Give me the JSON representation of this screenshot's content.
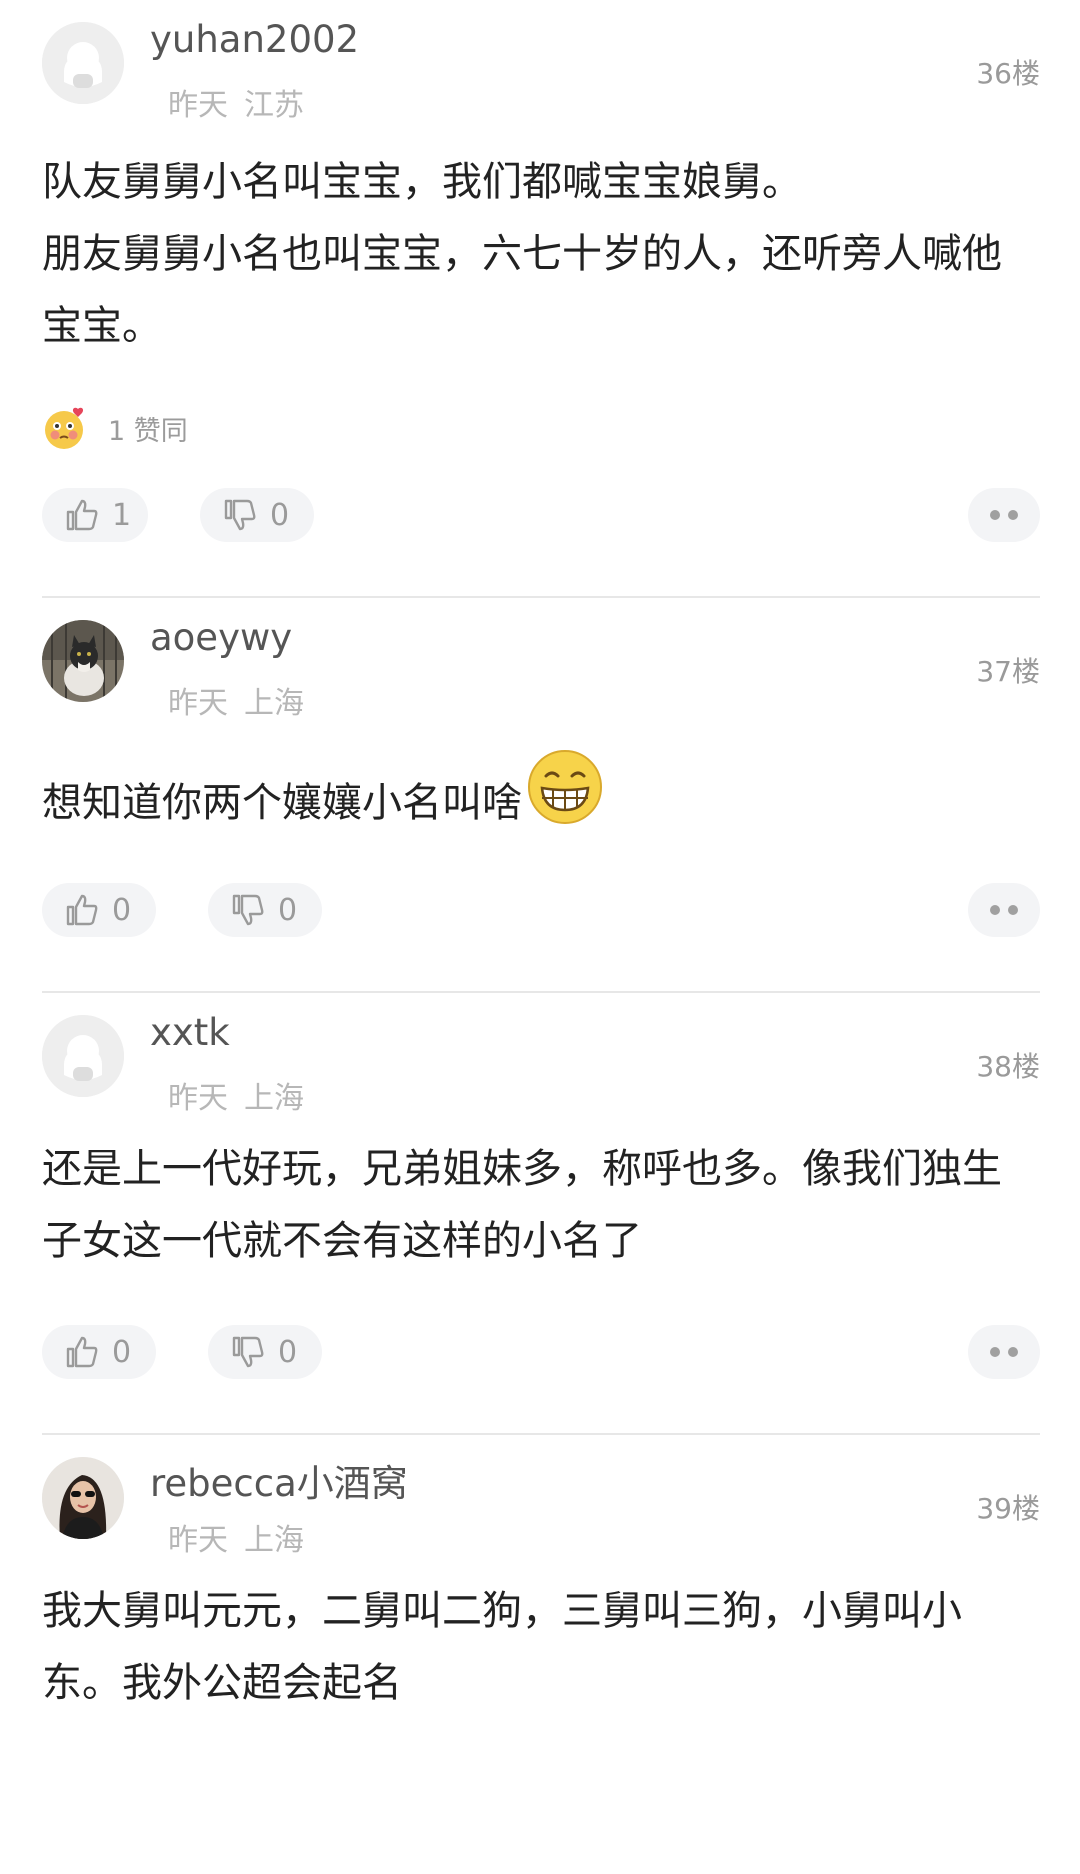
{
  "comments": [
    {
      "username": "yuhan2002",
      "time": "昨天",
      "location": "江苏",
      "floor": "36楼",
      "lines": [
        "队友舅舅小名叫宝宝，我们都喊宝宝娘舅。",
        "朋友舅舅小名也叫宝宝，六七十岁的人，还听旁人喊他宝宝。"
      ],
      "reaction_text": "1 赞同",
      "reaction_icon": "flushed-heart-emoji-icon",
      "likes": "1",
      "dislikes": "0",
      "avatar": "default-avatar-icon"
    },
    {
      "username": "aoeywy",
      "time": "昨天",
      "location": "上海",
      "floor": "37楼",
      "lines": [
        "想知道你两个孃孃小名叫啥"
      ],
      "inline_emoji": "grinning-face-emoji-icon",
      "likes": "0",
      "dislikes": "0",
      "avatar": "cat-photo-avatar"
    },
    {
      "username": "xxtk",
      "time": "昨天",
      "location": "上海",
      "floor": "38楼",
      "lines": [
        "还是上一代好玩，兄弟姐妹多，称呼也多。像我们独生子女这一代就不会有这样的小名了"
      ],
      "likes": "0",
      "dislikes": "0",
      "avatar": "default-avatar-icon"
    },
    {
      "username": "rebecca小酒窝",
      "time": "昨天",
      "location": "上海",
      "floor": "39楼",
      "lines": [
        "我大舅叫元元，二舅叫二狗，三舅叫三狗，小舅叫小东。我外公超会起名"
      ],
      "likes": "",
      "dislikes": "",
      "avatar": "woman-photo-avatar"
    }
  ],
  "colors": {
    "text": "#222222",
    "username": "#555555",
    "meta": "#b7b7b7",
    "pill_bg": "#f3f4f6",
    "divider": "#e7e7e7"
  }
}
